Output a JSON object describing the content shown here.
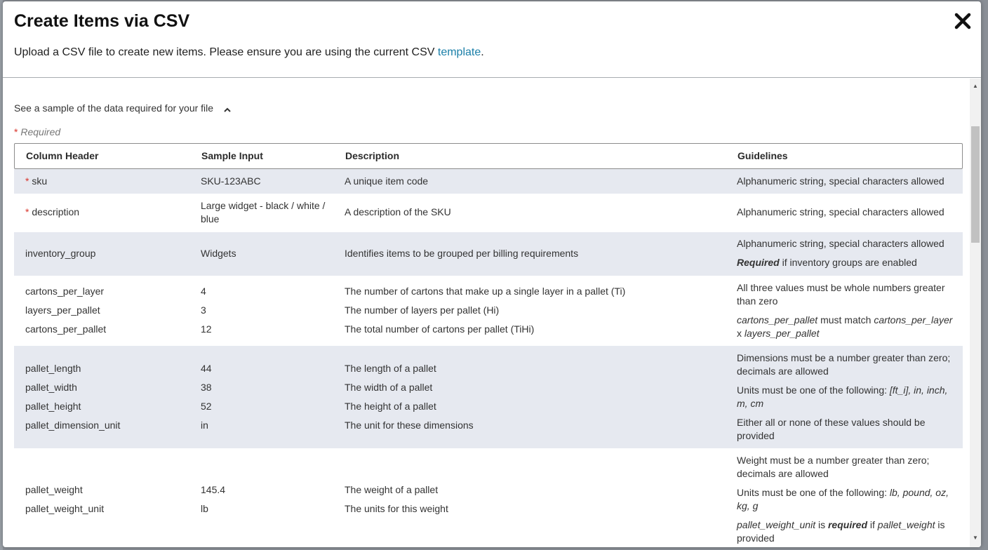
{
  "modal": {
    "title": "Create Items via CSV",
    "subtitle_before": "Upload a CSV file to create new items. Please ensure you are using the current CSV ",
    "template_link": "template",
    "subtitle_after": "."
  },
  "sample": {
    "toggle_label": "See a sample of the data required for your file",
    "required_star": "*",
    "required_label": "Required"
  },
  "table": {
    "headers": [
      "Column Header",
      "Sample Input",
      "Description",
      "Guidelines"
    ],
    "sku": {
      "star": "*",
      "name": "sku",
      "sample": "SKU-123ABC",
      "desc": "A unique item code",
      "guide": "Alphanumeric string, special characters allowed"
    },
    "description": {
      "star": "*",
      "name": "description",
      "sample": "Large widget - black / white / blue",
      "desc": "A description of the SKU",
      "guide": "Alphanumeric string, special characters allowed"
    },
    "inventory_group": {
      "name": "inventory_group",
      "sample": "Widgets",
      "desc": "Identifies items to be grouped per billing requirements",
      "guide1": "Alphanumeric string, special characters allowed",
      "guide2_bold": "Required",
      "guide2_rest": " if inventory groups are enabled"
    },
    "cartons": {
      "names": [
        "cartons_per_layer",
        "layers_per_pallet",
        "cartons_per_pallet"
      ],
      "samples": [
        "4",
        "3",
        "12"
      ],
      "descs": [
        "The number of cartons that make up a single layer in a pallet (Ti)",
        "The number of layers per pallet (Hi)",
        "The total number of cartons per pallet (TiHi)"
      ],
      "guide1": "All three values must be whole numbers greater than zero",
      "guide2_a": "cartons_per_pallet",
      "guide2_b": " must match ",
      "guide2_c": "cartons_per_layer",
      "guide2_d": " x ",
      "guide2_e": "layers_per_pallet"
    },
    "pallet_dims": {
      "names": [
        "pallet_length",
        "pallet_width",
        "pallet_height",
        "pallet_dimension_unit"
      ],
      "samples": [
        "44",
        "38",
        "52",
        "in"
      ],
      "descs": [
        "The length of a pallet",
        "The width of a pallet",
        "The height of a pallet",
        "The unit for these dimensions"
      ],
      "guide1": "Dimensions must be a number greater than zero; decimals are allowed",
      "guide2_a": "Units must be one of the following: ",
      "guide2_b": "[ft_i], in, inch, m, cm",
      "guide3": "Either all or none of these values should be provided"
    },
    "pallet_weight": {
      "names": [
        "pallet_weight",
        "pallet_weight_unit"
      ],
      "samples": [
        "145.4",
        "lb"
      ],
      "descs": [
        "The weight of a pallet",
        "The units for this weight"
      ],
      "guide1": "Weight must be a number greater than zero; decimals are allowed",
      "guide2_a": "Units must be one of the following: ",
      "guide2_b": "lb, pound, oz, kg, g",
      "guide3_a": "pallet_weight_unit",
      "guide3_b": " is ",
      "guide3_c": "required",
      "guide3_d": " if ",
      "guide3_e": "pallet_weight",
      "guide3_f": " is provided"
    }
  },
  "colors": {
    "link": "#1a7fa8",
    "required_star": "#d9342b",
    "row_shade": "#e6e9f0"
  }
}
